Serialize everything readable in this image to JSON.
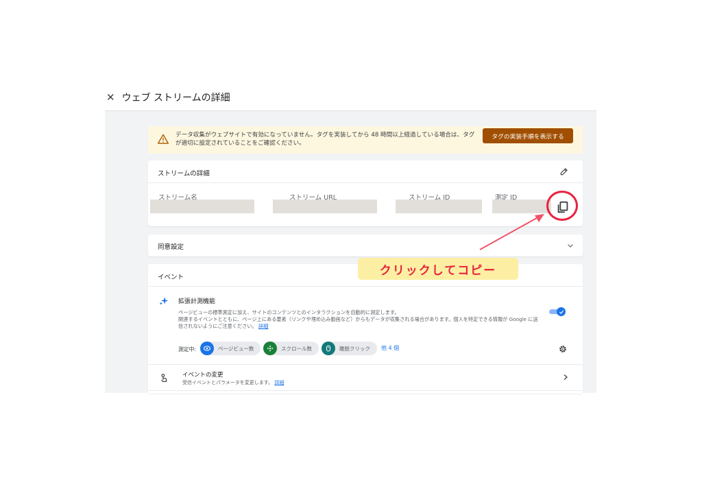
{
  "header": {
    "close_glyph": "✕",
    "title": "ウェブ ストリームの詳細"
  },
  "alert": {
    "icon": "warning-icon",
    "text": "データ収集がウェブサイトで有効になっていません。タグを実装してから 48 時間以上経過している場合は、タグが適切に設定されていることをご確認ください。",
    "button_label": "タグの実装手順を表示する",
    "button_color": "#a04f00",
    "background": "#fef7e0"
  },
  "stream_details": {
    "title": "ストリームの詳細",
    "fields": [
      {
        "label": "ストリーム名"
      },
      {
        "label": "ストリーム URL"
      },
      {
        "label": "ストリーム ID"
      },
      {
        "label": "測定 ID"
      }
    ]
  },
  "consent": {
    "title": "同意設定"
  },
  "events": {
    "title": "イベント",
    "enhanced": {
      "title": "拡張計測機能",
      "desc_1": "ページビューの標準測定に加え、サイトのコンテンツとのインタラクションを自動的に測定します。",
      "desc_2": "関連するイベントとともに、ページ上にある要素（リンクや埋め込み動画など）からもデータが収集される場合があります。個人を特定できる情報が Google に送信されないようにご注意ください。",
      "desc_link": "詳細",
      "toggle_on": true,
      "measuring_label": "測定中:",
      "chips": [
        {
          "label": "ページビュー数",
          "icon": "eye-icon",
          "color": "#1a73e8"
        },
        {
          "label": "スクロール数",
          "icon": "crosshair-icon",
          "color": "#188038"
        },
        {
          "label": "離脱クリック",
          "icon": "mouse-icon",
          "color": "#12797a"
        }
      ],
      "more_label": "他 4 個"
    },
    "modify": {
      "title": "イベントの変更",
      "desc": "受信イベントとパラメータを変更します。",
      "desc_link": "詳細"
    }
  },
  "annotation": {
    "callout_text": "クリックしてコピー",
    "accent_color": "#e8233f",
    "callout_bg": "#fcefa3"
  }
}
